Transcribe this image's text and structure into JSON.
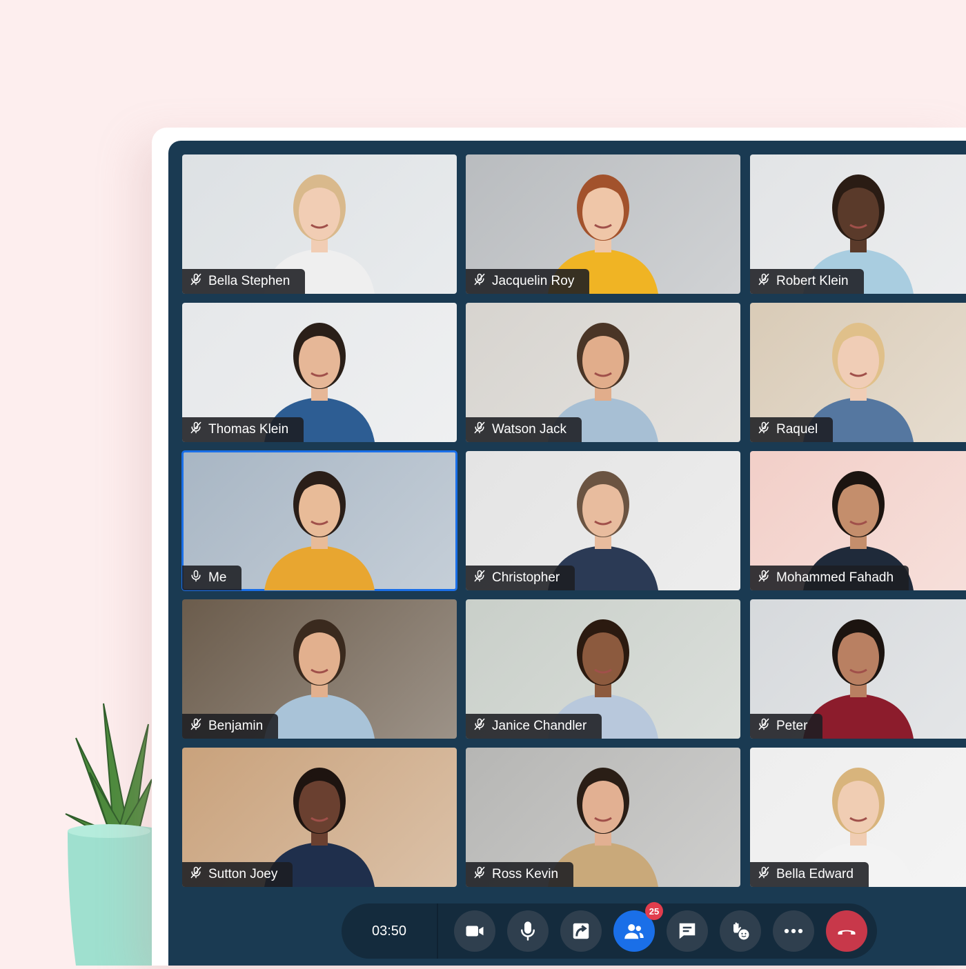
{
  "participants": [
    {
      "name": "Bella Stephen",
      "muted": true,
      "bg": "#dde1e4",
      "skin": "#f1cdb4",
      "hair": "#d9b98c",
      "shirt": "#efefef"
    },
    {
      "name": "Jacquelin Roy",
      "muted": true,
      "bg": "#b9bcbf",
      "skin": "#efc6a8",
      "hair": "#a2522c",
      "shirt": "#f0b424"
    },
    {
      "name": "Robert Klein",
      "muted": true,
      "bg": "#e2e4e6",
      "skin": "#5a3a2a",
      "hair": "#2a1c14",
      "shirt": "#a9cde0"
    },
    {
      "name": "Thomas Klein",
      "muted": true,
      "bg": "#e6e8ea",
      "skin": "#e6b797",
      "hair": "#2a1f18",
      "shirt": "#2d5d93"
    },
    {
      "name": "Watson Jack",
      "muted": true,
      "bg": "#d7d4cf",
      "skin": "#e1ad8b",
      "hair": "#4a3526",
      "shirt": "#a7bfd4"
    },
    {
      "name": "Raquel",
      "muted": true,
      "bg": "#d9cbb7",
      "skin": "#f0cdb6",
      "hair": "#e0c08a",
      "shirt": "#5577a0"
    },
    {
      "name": "Me",
      "muted": false,
      "bg": "#a8b6c4",
      "skin": "#e8bb98",
      "hair": "#2a1e18",
      "shirt": "#e8a630"
    },
    {
      "name": "Christopher",
      "muted": true,
      "bg": "#e4e4e4",
      "skin": "#e8bc9e",
      "hair": "#6b5442",
      "shirt": "#2b3a55"
    },
    {
      "name": "Mohammed Fahadh",
      "muted": true,
      "bg": "#f2cfc8",
      "skin": "#c48e6c",
      "hair": "#1c1410",
      "shirt": "#1f2a3a"
    },
    {
      "name": "Benjamin",
      "muted": true,
      "bg": "#6b5c4c",
      "skin": "#e2b08e",
      "hair": "#3a2a1e",
      "shirt": "#a9c3d8"
    },
    {
      "name": "Janice Chandler",
      "muted": true,
      "bg": "#c9cfc9",
      "skin": "#8c5a3e",
      "hair": "#2b1a10",
      "shirt": "#b8c8dc"
    },
    {
      "name": "Peter",
      "muted": true,
      "bg": "#d6d9dc",
      "skin": "#b98062",
      "hair": "#1c1410",
      "shirt": "#8c1c2c"
    },
    {
      "name": "Sutton Joey",
      "muted": true,
      "bg": "#c9a27c",
      "skin": "#6a4030",
      "hair": "#1e1410",
      "shirt": "#1f2f4c"
    },
    {
      "name": "Ross Kevin",
      "muted": true,
      "bg": "#b6b6b4",
      "skin": "#e2b092",
      "hair": "#2a1e16",
      "shirt": "#c9a97a"
    },
    {
      "name": "Bella Edward",
      "muted": true,
      "bg": "#eeeeee",
      "skin": "#f0cdb3",
      "hair": "#d8b47c",
      "shirt": "#f3f3f3"
    }
  ],
  "controls": {
    "timer": "03:50",
    "buttons": [
      {
        "id": "camera",
        "icon": "video-camera-icon"
      },
      {
        "id": "mic",
        "icon": "microphone-icon"
      },
      {
        "id": "share",
        "icon": "share-screen-icon"
      },
      {
        "id": "participants",
        "icon": "participants-icon",
        "active": true,
        "badge": "25"
      },
      {
        "id": "chat",
        "icon": "chat-icon"
      },
      {
        "id": "reactions",
        "icon": "raise-hand-emoji-icon"
      },
      {
        "id": "more",
        "icon": "more-icon"
      },
      {
        "id": "leave",
        "icon": "hang-up-icon"
      }
    ],
    "colors": {
      "active": "#1a6fe8",
      "leave": "#c8384a",
      "badge": "#e23d4d"
    }
  }
}
